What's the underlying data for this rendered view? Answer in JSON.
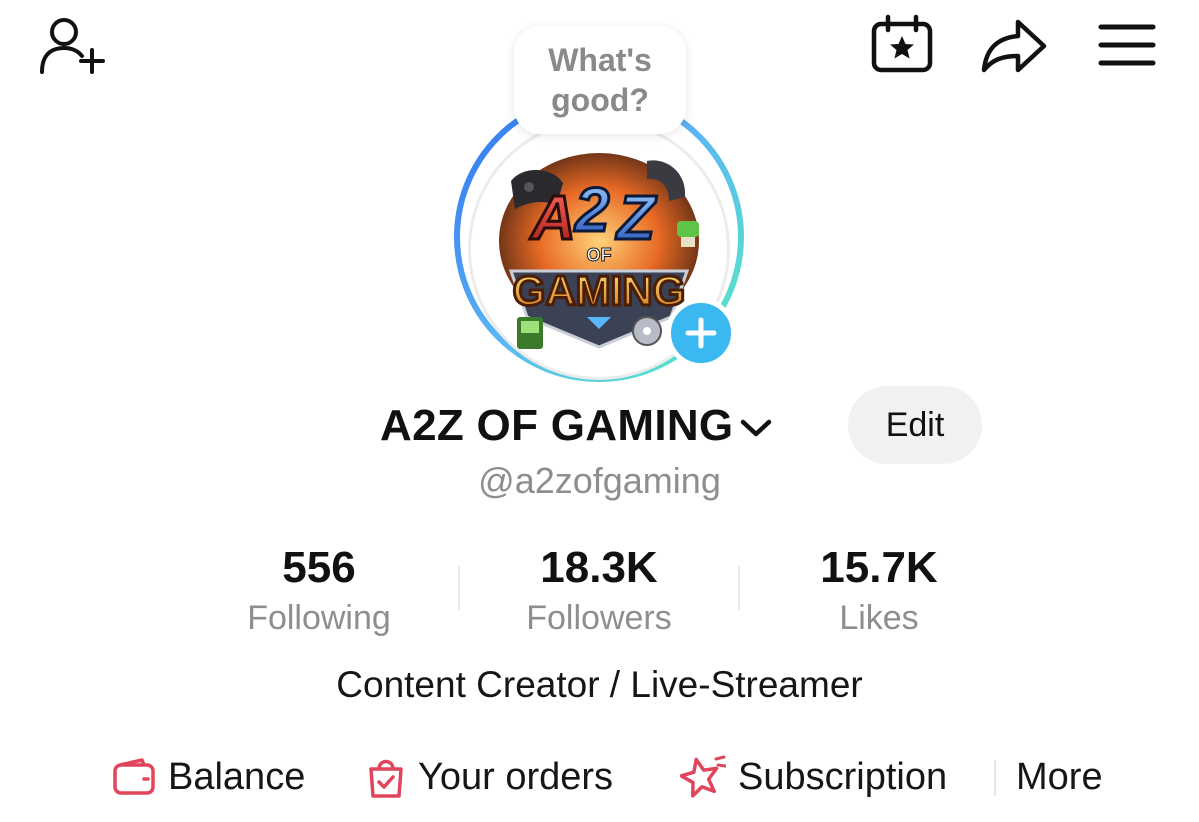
{
  "header": {
    "icons": [
      "add-friend-icon",
      "calendar-star-icon",
      "share-icon",
      "menu-icon"
    ]
  },
  "avatar": {
    "bubble_text": "What's\ngood?",
    "logo_text": {
      "top": "A2Z",
      "middle": "OF",
      "bottom": "GAMING"
    },
    "add_icon": "plus-icon"
  },
  "profile": {
    "display_name": "A2Z OF GAMING",
    "edit_label": "Edit",
    "handle": "@a2zofgaming",
    "bio": "Content Creator / Live-Streamer"
  },
  "stats": [
    {
      "value": "556",
      "label": "Following"
    },
    {
      "value": "18.3K",
      "label": "Followers"
    },
    {
      "value": "15.7K",
      "label": "Likes"
    }
  ],
  "links": [
    {
      "label": "Balance",
      "icon": "wallet-icon"
    },
    {
      "label": "Your orders",
      "icon": "shopping-bag-icon"
    },
    {
      "label": "Subscription",
      "icon": "subscription-star-icon"
    }
  ],
  "more_label": "More",
  "colors": {
    "accent_red": "#e0455c",
    "ring_blue": "#3a86f5",
    "ring_teal": "#4fe0c7",
    "add_button": "#3ab8ef",
    "muted_text": "#8e8e8e"
  }
}
